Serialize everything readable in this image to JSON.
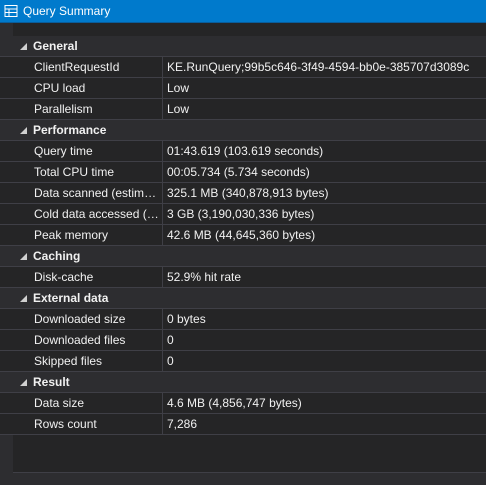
{
  "window": {
    "title": "Query Summary",
    "accent_color": "#007acc",
    "icon": "table-grid-icon"
  },
  "categories": [
    {
      "label": "General",
      "expanded": true,
      "properties": [
        {
          "name": "ClientRequestId",
          "value": "KE.RunQuery;99b5c646-3f49-4594-bb0e-385707d3089c"
        },
        {
          "name": "CPU load",
          "value": "Low"
        },
        {
          "name": "Parallelism",
          "value": "Low"
        }
      ]
    },
    {
      "label": "Performance",
      "expanded": true,
      "properties": [
        {
          "name": "Query time",
          "value": "01:43.619 (103.619 seconds)"
        },
        {
          "name": "Total CPU time",
          "value": "00:05.734 (5.734 seconds)"
        },
        {
          "name": "Data scanned (estimat...",
          "value": "325.1 MB (340,878,913 bytes)"
        },
        {
          "name": "Cold data accessed (e...",
          "value": "3 GB (3,190,030,336 bytes)"
        },
        {
          "name": "Peak memory",
          "value": "42.6 MB (44,645,360 bytes)"
        }
      ]
    },
    {
      "label": "Caching",
      "expanded": true,
      "properties": [
        {
          "name": "Disk-cache",
          "value": "52.9% hit rate"
        }
      ]
    },
    {
      "label": "External data",
      "expanded": true,
      "properties": [
        {
          "name": "Downloaded size",
          "value": "0 bytes"
        },
        {
          "name": "Downloaded files",
          "value": "0"
        },
        {
          "name": "Skipped files",
          "value": "0"
        }
      ]
    },
    {
      "label": "Result",
      "expanded": true,
      "properties": [
        {
          "name": "Data size",
          "value": "4.6 MB (4,856,747 bytes)"
        },
        {
          "name": "Rows count",
          "value": "7,286"
        }
      ]
    }
  ]
}
